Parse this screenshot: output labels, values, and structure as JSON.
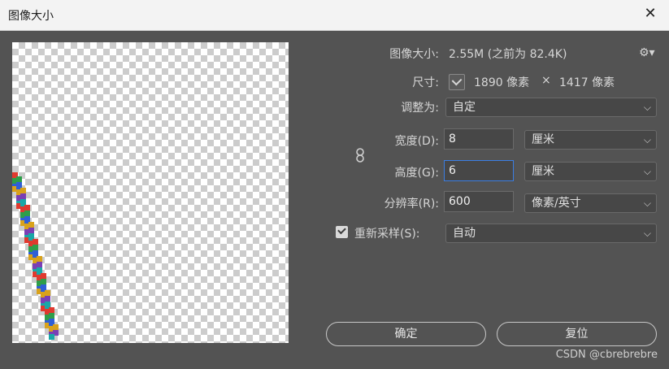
{
  "window": {
    "title": "图像大小",
    "close_glyph": "✕"
  },
  "image_size": {
    "label": "图像大小:",
    "value": "2.55M (之前为 82.4K)"
  },
  "dimensions": {
    "label": "尺寸:",
    "width": "1890 像素",
    "times": "×",
    "height": "1417 像素"
  },
  "fit_to": {
    "label": "调整为:",
    "value": "自定"
  },
  "width": {
    "label": "宽度(D):",
    "value": "8",
    "unit": "厘米"
  },
  "height": {
    "label": "高度(G):",
    "value": "6",
    "unit": "厘米"
  },
  "resolution": {
    "label": "分辨率(R):",
    "value": "600",
    "unit": "像素/英寸"
  },
  "resample": {
    "label": "重新采样(S):",
    "value": "自动",
    "checked": true
  },
  "buttons": {
    "ok": "确定",
    "reset": "复位"
  },
  "watermark": "CSDN @cbrebrebre",
  "icons": {
    "gear": "gear-icon",
    "link": "link-icon",
    "chevron": "chevron-down-icon"
  },
  "colors": {
    "accent": "#3b7ee3",
    "bg": "#535353",
    "field": "#474747"
  }
}
